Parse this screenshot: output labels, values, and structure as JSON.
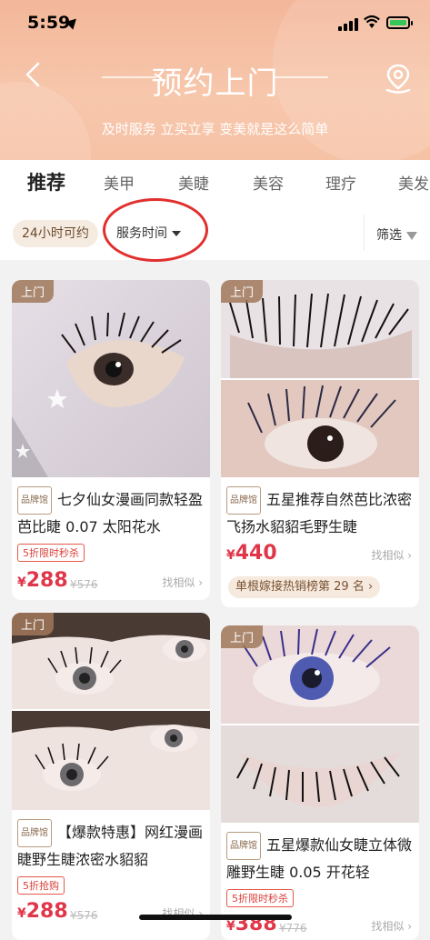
{
  "status": {
    "time": "5:59"
  },
  "header": {
    "title": "预约上门",
    "subtitle": "及时服务 立买立享 变美就是这么简单"
  },
  "tabs": [
    {
      "label": "推荐",
      "active": true
    },
    {
      "label": "美甲"
    },
    {
      "label": "美睫"
    },
    {
      "label": "美容"
    },
    {
      "label": "理疗"
    },
    {
      "label": "美发"
    }
  ],
  "filters": {
    "chip_24h": "24小时可约",
    "service_time": "服务时间",
    "filter_label": "筛选"
  },
  "products": [
    {
      "tag": "上门",
      "brand": "品牌馆",
      "title": "七夕仙女漫画同款轻盈芭比睫 0.07 太阳花水",
      "promo": "5折限时秒杀",
      "currency": "¥",
      "price": "288",
      "old_price": "¥576",
      "similar": "找相似 ›"
    },
    {
      "tag": "上门",
      "brand": "品牌馆",
      "title": "五星推荐自然芭比浓密飞扬水貂貂毛野生睫",
      "currency": "¥",
      "price": "440",
      "similar": "找相似 ›",
      "rank": "单根嫁接热销榜第 29 名 ›"
    },
    {
      "tag": "上门",
      "brand": "品牌馆",
      "title": "【爆款特惠】网红漫画睫野生睫浓密水貂貂",
      "promo": "5折抢购",
      "currency": "¥",
      "price": "288",
      "old_price": "¥576",
      "similar": "找相似 ›"
    },
    {
      "tag": "上门",
      "brand": "品牌馆",
      "title": "五星爆款仙女睫立体微雕野生睫 0.05 开花轻",
      "promo": "5折限时秒杀",
      "currency": "¥",
      "price": "388",
      "old_price": "¥776",
      "similar": "找相似 ›"
    }
  ]
}
